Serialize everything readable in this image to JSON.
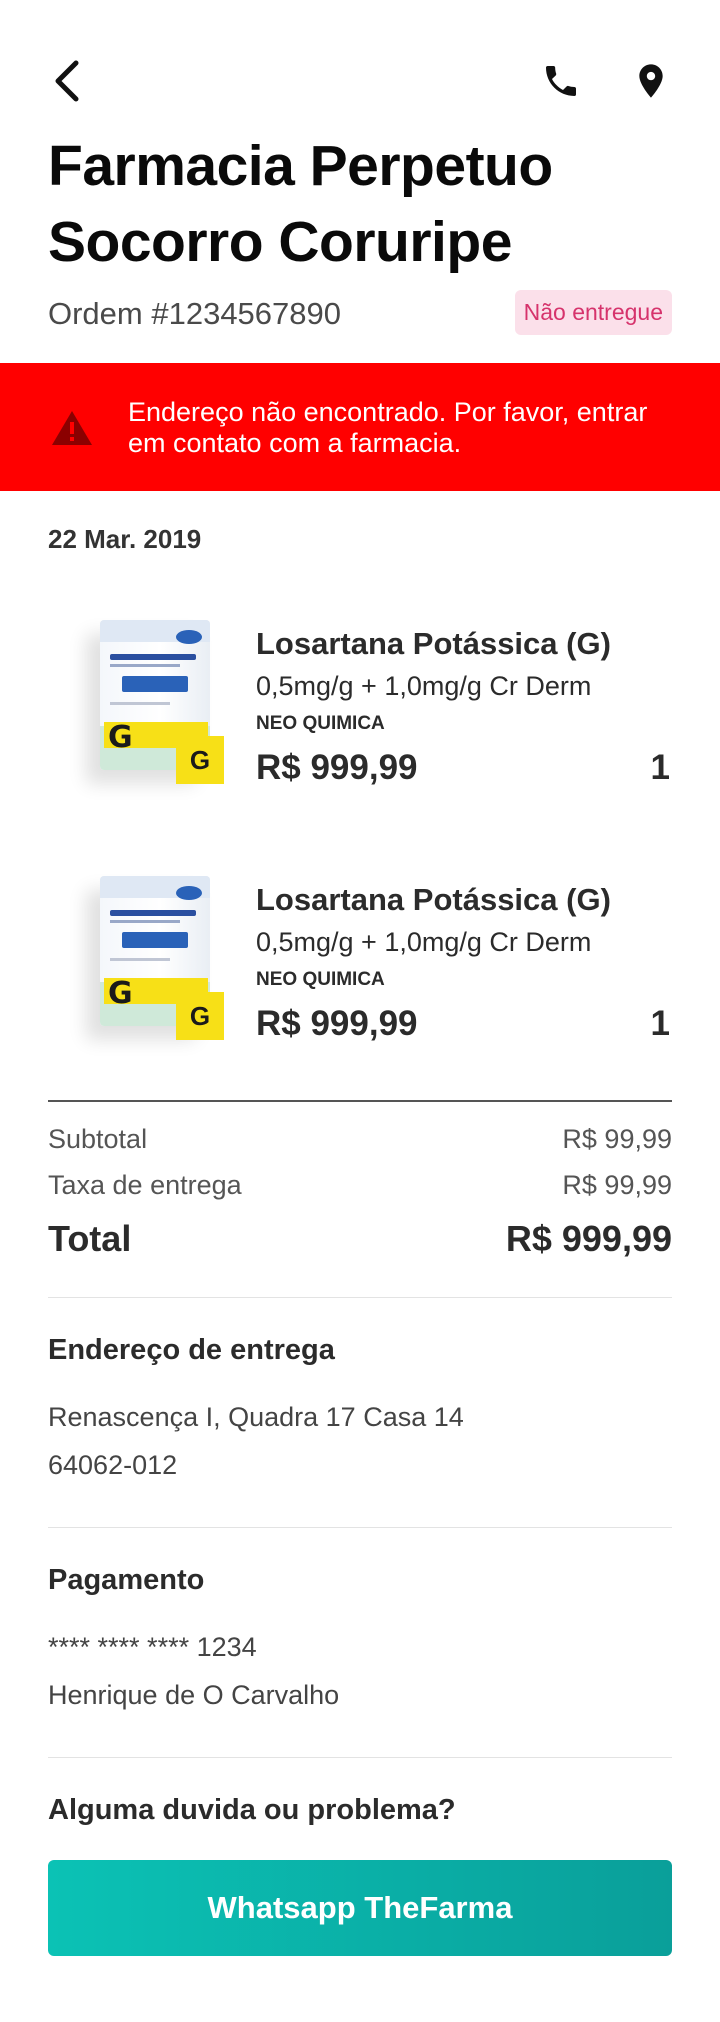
{
  "header": {
    "title": "Farmacia Perpetuo Socorro Coruripe",
    "order_number": "Ordem #1234567890",
    "status": "Não entregue"
  },
  "alert": {
    "message": "Endereço não encontrado. Por favor, entrar em contato com a farmacia."
  },
  "order_date": "22 Mar. 2019",
  "products": [
    {
      "name": "Losartana Potássica (G)",
      "dose": "0,5mg/g + 1,0mg/g Cr Derm",
      "maker": "NEO QUIMICA",
      "price": "R$ 999,99",
      "qty": "1",
      "badge": "G"
    },
    {
      "name": "Losartana Potássica (G)",
      "dose": "0,5mg/g + 1,0mg/g Cr Derm",
      "maker": "NEO QUIMICA",
      "price": "R$ 999,99",
      "qty": "1",
      "badge": "G"
    }
  ],
  "summary": {
    "subtotal_label": "Subtotal",
    "subtotal_value": "R$ 99,99",
    "delivery_label": "Taxa de entrega",
    "delivery_value": "R$ 99,99",
    "total_label": "Total",
    "total_value": "R$ 999,99"
  },
  "delivery": {
    "title": "Endereço de entrega",
    "address_line1": "Renascença I, Quadra 17 Casa 14",
    "address_line2": "64062-012"
  },
  "payment": {
    "title": "Pagamento",
    "card": "**** **** **** 1234",
    "holder": "Henrique de O Carvalho"
  },
  "help": {
    "title": "Alguma duvida ou problema?",
    "button_label": "Whatsapp TheFarma"
  },
  "colors": {
    "alert_bg": "#ff0000",
    "badge_bg": "#fbe0ea",
    "badge_text": "#d6336c",
    "button_start": "#0bc2b5",
    "button_end": "#0a9f9a",
    "generic_yellow": "#f7e017"
  },
  "icons": {
    "back": "chevron-left-icon",
    "phone": "phone-icon",
    "location": "location-pin-icon",
    "warning": "warning-icon"
  }
}
